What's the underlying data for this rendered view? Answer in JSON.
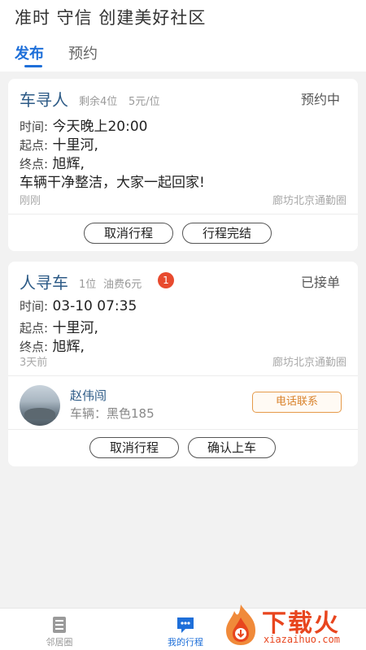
{
  "header": {
    "title": "准时 守信 创建美好社区",
    "tabs": [
      {
        "label": "发布",
        "active": true
      },
      {
        "label": "预约",
        "active": false
      }
    ],
    "accent_color": "#1e6fd9"
  },
  "cards": [
    {
      "type": "车寻人",
      "meta1": "剩余4位",
      "meta2": "5元/位",
      "status": "预约中",
      "time_label": "时间:",
      "time_value": "今天晚上20:00",
      "from_label": "起点:",
      "from_value": "十里河,",
      "to_label": "终点:",
      "to_value": "旭辉,",
      "note": "车辆干净整洁，大家一起回家!",
      "posted": "刚刚",
      "area": "廊坊北京通勤圈",
      "buttons": [
        "取消行程",
        "行程完结"
      ]
    },
    {
      "type": "人寻车",
      "meta1": "1位",
      "meta2": "油费6元",
      "badge": "1",
      "status": "已接单",
      "time_label": "时间:",
      "time_value": "03-10 07:35",
      "from_label": "起点:",
      "from_value": "十里河,",
      "to_label": "终点:",
      "to_value": "旭辉,",
      "posted": "3天前",
      "area": "廊坊北京通勤圈",
      "driver": {
        "name": "赵伟闯",
        "car": "车辆：黑色185",
        "call_label": "电话联系"
      },
      "buttons": [
        "取消行程",
        "确认上车"
      ]
    }
  ],
  "bottom_nav": [
    {
      "label": "邻居圈",
      "icon": "neighbor-circle-icon",
      "active": false
    },
    {
      "label": "我的行程",
      "icon": "my-trips-icon",
      "active": true
    }
  ],
  "watermark": {
    "text": "下载火",
    "sub": "xiazaihuo.com",
    "color": "#e8451e"
  }
}
